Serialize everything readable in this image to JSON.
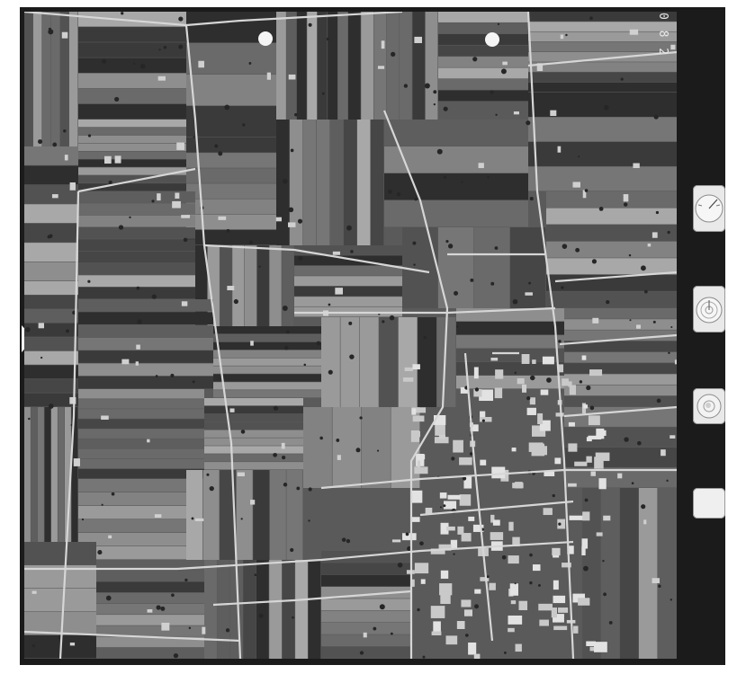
{
  "frame": {
    "number_label": "0 8 2",
    "instruments": [
      {
        "name": "altimeter-dial"
      },
      {
        "name": "clock-dial"
      },
      {
        "name": "level-bubble"
      },
      {
        "name": "data-plate"
      }
    ]
  },
  "colors": {
    "film_border": "#1b1b1b",
    "paper": "#ffffff",
    "field_dark": "#3a3a3a",
    "field_mid": "#6a6a6a",
    "field_light": "#a8a8a8",
    "road": "#d8d8d8"
  }
}
